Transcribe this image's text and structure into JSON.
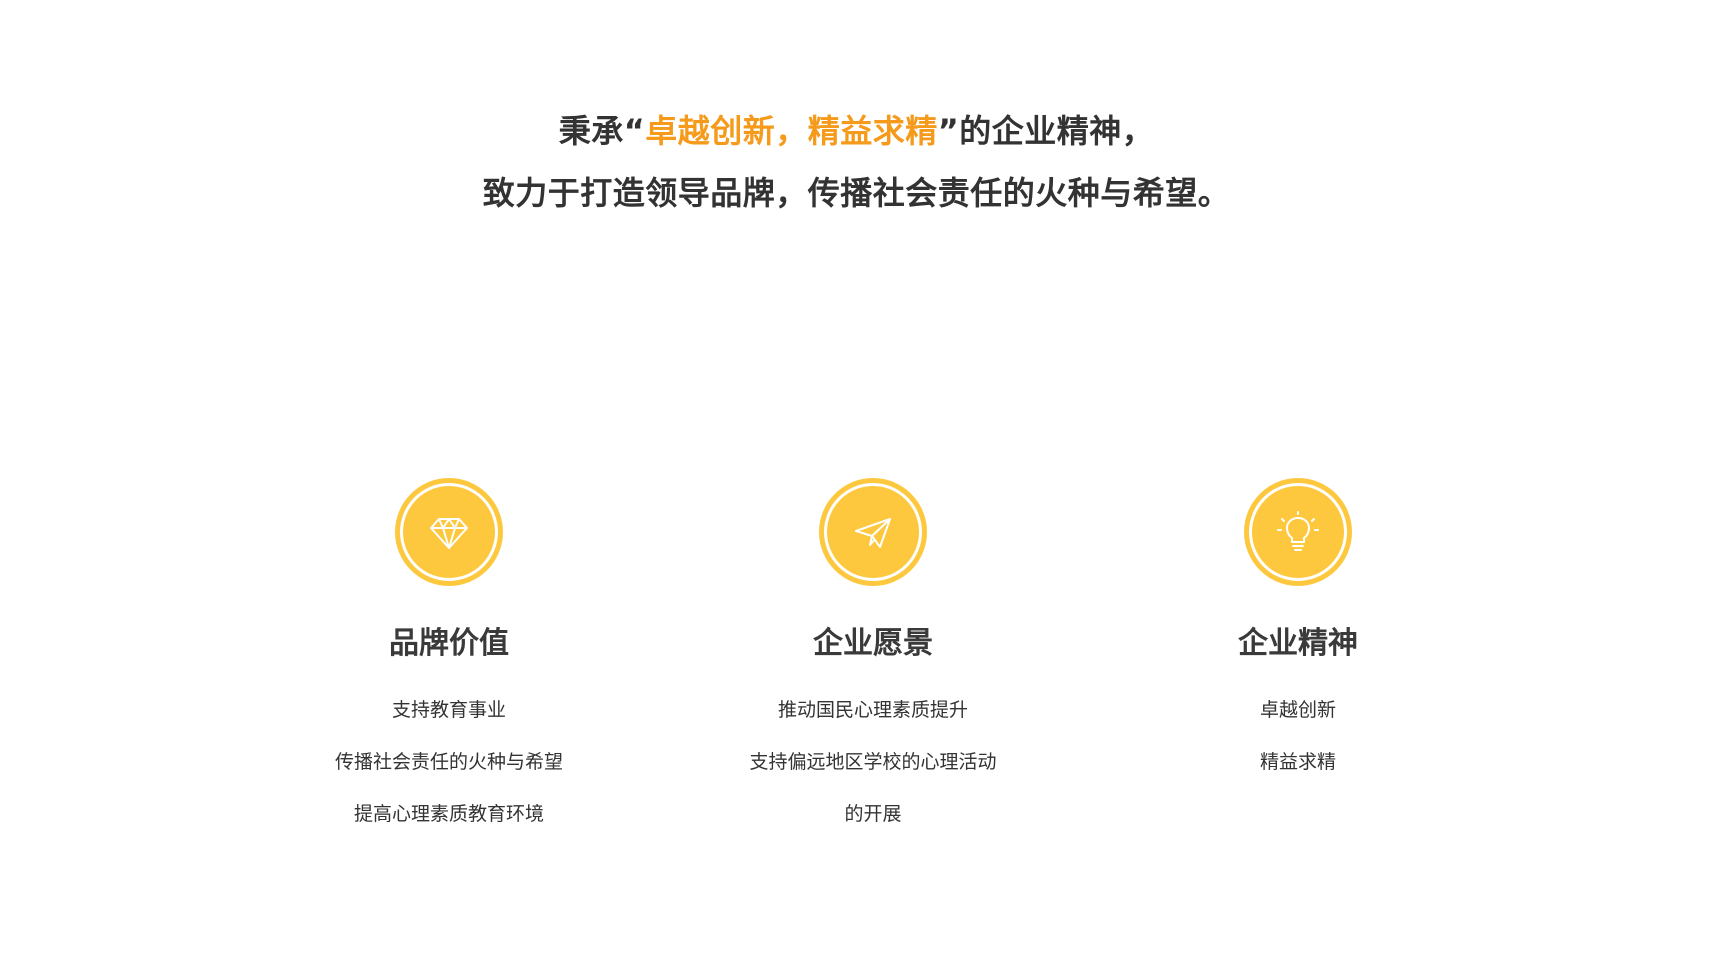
{
  "headline": {
    "line1_prefix": "秉承“",
    "line1_accent": "卓越创新，精益求精",
    "line1_suffix": "”的企业精神，",
    "line2": "致力于打造领导品牌，传播社会责任的火种与希望。",
    "accent_color": "#f59a1b"
  },
  "features": [
    {
      "icon": "diamond-icon",
      "title": "品牌价值",
      "lines": [
        "支持教育事业",
        "传播社会责任的火种与希望",
        "提高心理素质教育环境"
      ]
    },
    {
      "icon": "paper-plane-icon",
      "title": "企业愿景",
      "lines": [
        "推动国民心理素质提升",
        "支持偏远地区学校的心理活动",
        "的开展"
      ]
    },
    {
      "icon": "lightbulb-icon",
      "title": "企业精神",
      "lines": [
        "卓越创新",
        "精益求精"
      ]
    }
  ],
  "badge_color": "#fdc83e"
}
